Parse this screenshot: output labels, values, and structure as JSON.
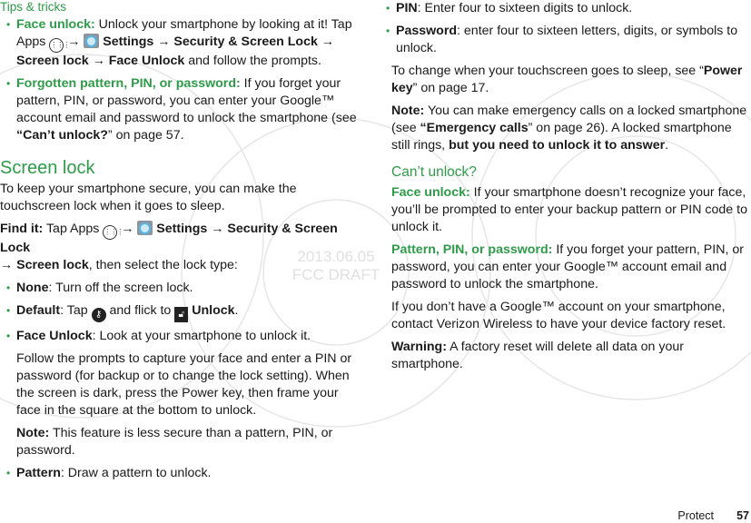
{
  "left": {
    "tips_heading": "Tips & tricks",
    "tip1": {
      "label": "Face unlock:",
      "text1": " Unlock your smartphone by looking at it! Tap Apps ",
      "apps_icon": "apps-icon",
      "arrow": " → ",
      "settings": " Settings",
      "arrow2": " → ",
      "security": "Security & Screen Lock",
      "arrow3": " → ",
      "screen_lock": "Screen lock",
      "arrow4": " → ",
      "face_unlock": "Face Unlock",
      "text2": " and follow the prompts."
    },
    "tip2": {
      "label": "Forgotten pattern, PIN, or password:",
      "text1": " If you forget your pattern, PIN, or password, you can enter your Google™ account email and password to unlock the smartphone (see ",
      "link": "“Can’t unlock?",
      "text2": "” on page 57."
    },
    "section_title": "Screen lock",
    "intro": "To keep your smartphone secure, you can make the touchscreen lock when it goes to sleep.",
    "find_it": {
      "label": "Find it:",
      "text1": " Tap Apps ",
      "arrow": " → ",
      "settings": " Settings",
      "arrow2": " → ",
      "security": "Security & Screen Lock",
      "arrow3": "→ ",
      "screen_lock": "Screen lock",
      "text2": ", then select the lock type:"
    },
    "items": [
      {
        "label": "None",
        "text": ": Turn off the screen lock."
      },
      {
        "label": "Default",
        "text_a": ": Tap ",
        "text_b": " and flick to ",
        "unlock": "Unlock",
        "text_c": "."
      },
      {
        "label": "Face Unlock",
        "text": ": Look at your smartphone to unlock it."
      }
    ],
    "face_unlock_detail": "Follow the prompts to capture your face and enter a PIN or password (for backup or to change the lock setting). When the screen is dark, press the Power key, then frame your face in the square at the bottom to unlock.",
    "note_label": "Note:",
    "note_text": " This feature is less secure than a pattern, PIN, or password.",
    "pattern": {
      "label": "Pattern",
      "text": ": Draw a pattern to unlock."
    }
  },
  "right": {
    "pin": {
      "label": "PIN",
      "text": ": Enter four to sixteen digits to unlock."
    },
    "password": {
      "label": "Password",
      "text": ": enter four to sixteen letters, digits, or symbols to unlock."
    },
    "sleep": {
      "text1": "To change when your touchscreen goes to sleep, see “",
      "link": "Power key",
      "text2": "” on page 17."
    },
    "note": {
      "label": "Note:",
      "text1": " You can make emergency calls on a locked smartphone (see ",
      "link": "“Emergency calls",
      "text2": "” on page 26). A locked smartphone still rings, ",
      "bold": "but you need to unlock it to answer",
      "text3": "."
    },
    "cant_unlock_title": "Can’t unlock?",
    "face": {
      "label": "Face unlock:",
      "text": " If your smartphone doesn’t recognize your face, you’ll be prompted to enter your backup pattern or PIN code to unlock it."
    },
    "ppp": {
      "label": "Pattern, PIN, or password:",
      "text": " If you forget your pattern, PIN, or password, you can enter your Google™ account email and password to unlock the smartphone."
    },
    "no_google": "If you don’t have a Google™ account on your smartphone, contact Verizon Wireless to have your device factory reset.",
    "warning": {
      "label": "Warning:",
      "text": " A factory reset will delete all data on your smartphone."
    }
  },
  "watermark": {
    "date": "2013.06.05",
    "draft": "FCC DRAFT"
  },
  "footer": {
    "section": "Protect",
    "page": "57"
  },
  "colors": {
    "accent_green": "#2e9b48"
  }
}
